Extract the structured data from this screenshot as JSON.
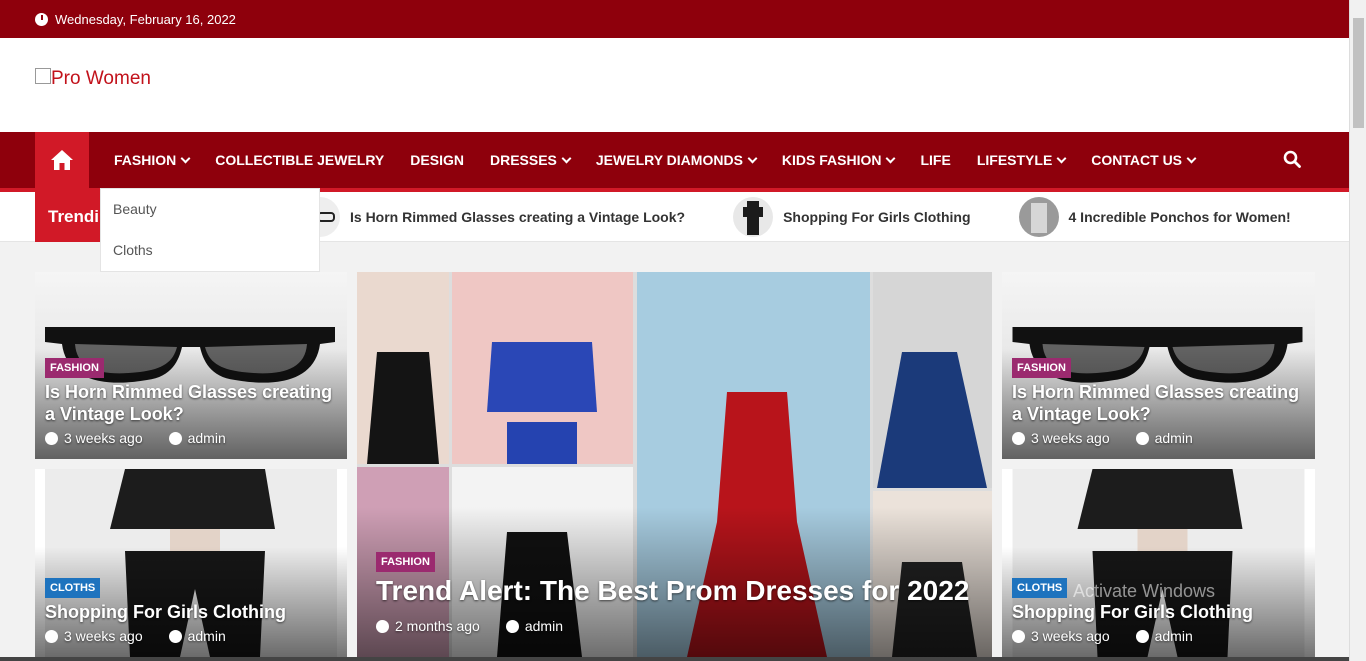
{
  "topbar": {
    "date": "Wednesday, February 16, 2022"
  },
  "logo": {
    "alt": "Pro Women"
  },
  "nav": {
    "items": [
      {
        "label": "FASHION",
        "dropdown": true
      },
      {
        "label": "COLLECTIBLE JEWELRY",
        "dropdown": false
      },
      {
        "label": "DESIGN",
        "dropdown": false
      },
      {
        "label": "DRESSES",
        "dropdown": true
      },
      {
        "label": "JEWELRY DIAMONDS",
        "dropdown": true
      },
      {
        "label": "KIDS FASHION",
        "dropdown": true
      },
      {
        "label": "LIFE",
        "dropdown": false
      },
      {
        "label": "LIFESTYLE",
        "dropdown": true
      },
      {
        "label": "CONTACT US",
        "dropdown": true
      }
    ],
    "dropdown": [
      "Beauty",
      "Cloths"
    ]
  },
  "trending": {
    "label": "Trending",
    "items": [
      "Is Horn Rimmed Glasses creating a Vintage Look?",
      "Shopping For Girls Clothing",
      "4 Incredible Ponchos for Women!"
    ]
  },
  "cards": {
    "left_top": {
      "category": "FASHION",
      "title": "Is Horn Rimmed Glasses creating a Vintage Look?",
      "time": "3 weeks ago",
      "author": "admin"
    },
    "left_bottom": {
      "category": "CLOTHS",
      "title": "Shopping For Girls Clothing",
      "time": "3 weeks ago",
      "author": "admin"
    },
    "center": {
      "category": "FASHION",
      "title": "Trend Alert: The Best Prom Dresses for 2022",
      "time": "2 months ago",
      "author": "admin"
    },
    "right_top": {
      "category": "FASHION",
      "title": "Is Horn Rimmed Glasses creating a Vintage Look?",
      "time": "3 weeks ago",
      "author": "admin"
    },
    "right_bottom": {
      "category": "CLOTHS",
      "title": "Shopping For Girls Clothing",
      "time": "3 weeks ago",
      "author": "admin"
    }
  },
  "colors": {
    "top": "#8e000c",
    "accent": "#d11927",
    "fashion_badge": "#9b2a6f",
    "cloths_badge": "#1e73be"
  },
  "watermark": "Activate Windows"
}
